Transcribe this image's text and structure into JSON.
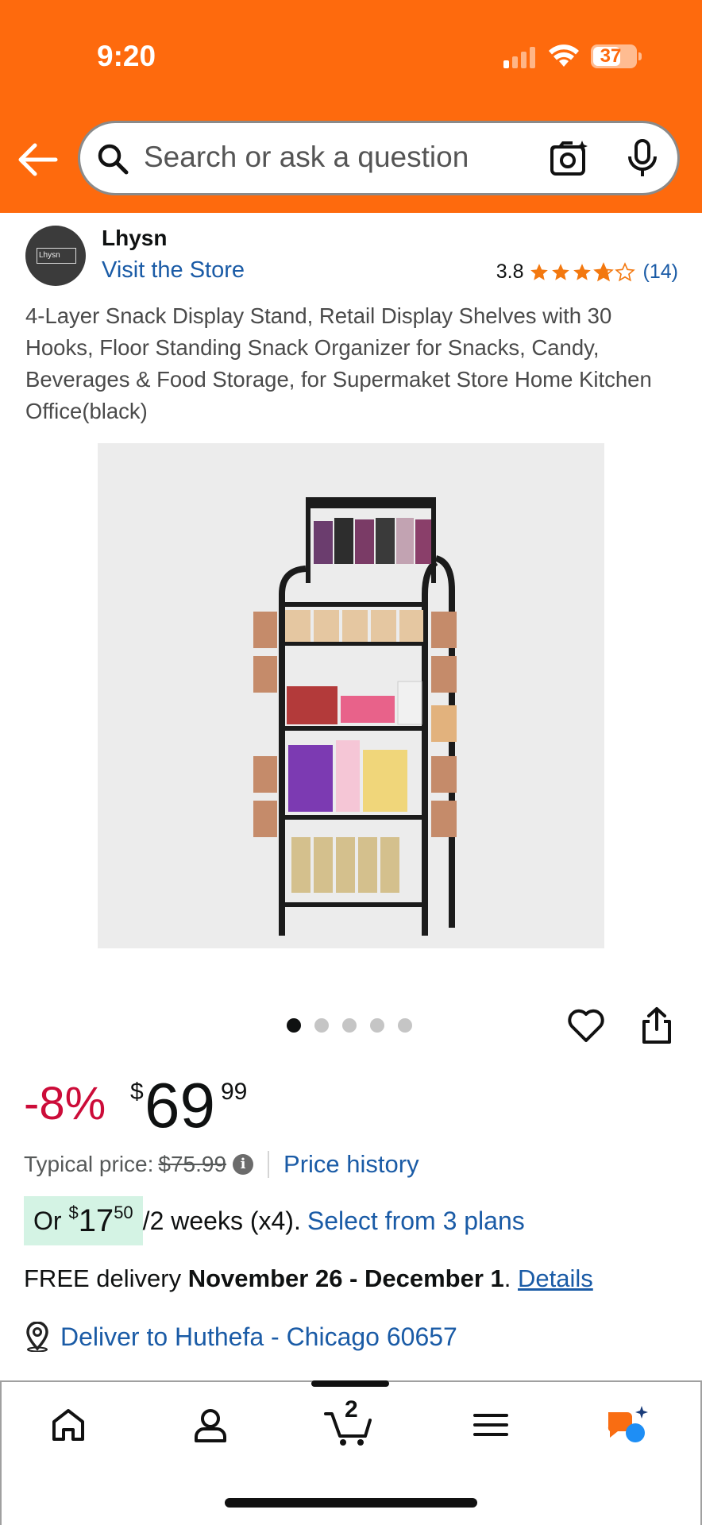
{
  "status_bar": {
    "time": "9:20",
    "battery": "37"
  },
  "search": {
    "placeholder": "Search or ask a question"
  },
  "brand": {
    "logo_text": "Lhysn",
    "name": "Lhysn",
    "visit_label": "Visit the Store"
  },
  "rating": {
    "value": "3.8",
    "stars": 3.8,
    "count": "(14)"
  },
  "product": {
    "title": "4-Layer Snack Display Stand, Retail Display Shelves with 30 Hooks, Floor Standing Snack Organizer for Snacks, Candy, Beverages & Food Storage, for Supermaket Store Home Kitchen Office(black)",
    "image_count": 5,
    "active_image": 1
  },
  "price": {
    "discount": "-8%",
    "currency": "$",
    "whole": "69",
    "fraction": "99",
    "typical_label": "Typical price:",
    "typical_value": "$75.99",
    "price_history_label": "Price history"
  },
  "plan": {
    "prefix": "Or ",
    "currency": "$",
    "whole": "17",
    "fraction": "50",
    "suffix": "/2 weeks (x4).",
    "link": "Select from 3 plans"
  },
  "delivery": {
    "prefix": "FREE delivery ",
    "dates": "November 26 - December 1",
    "period": ". ",
    "details_link": "Details",
    "deliver_to": "Deliver to Huthefa - Chicago 60657"
  },
  "bottom_nav": {
    "cart_count": "2"
  },
  "colors": {
    "header": "#fe6a0d",
    "link": "#1a5ba6",
    "discount": "#cc0c39",
    "star": "#f3780f",
    "plan_bg": "#d4f3e4"
  }
}
